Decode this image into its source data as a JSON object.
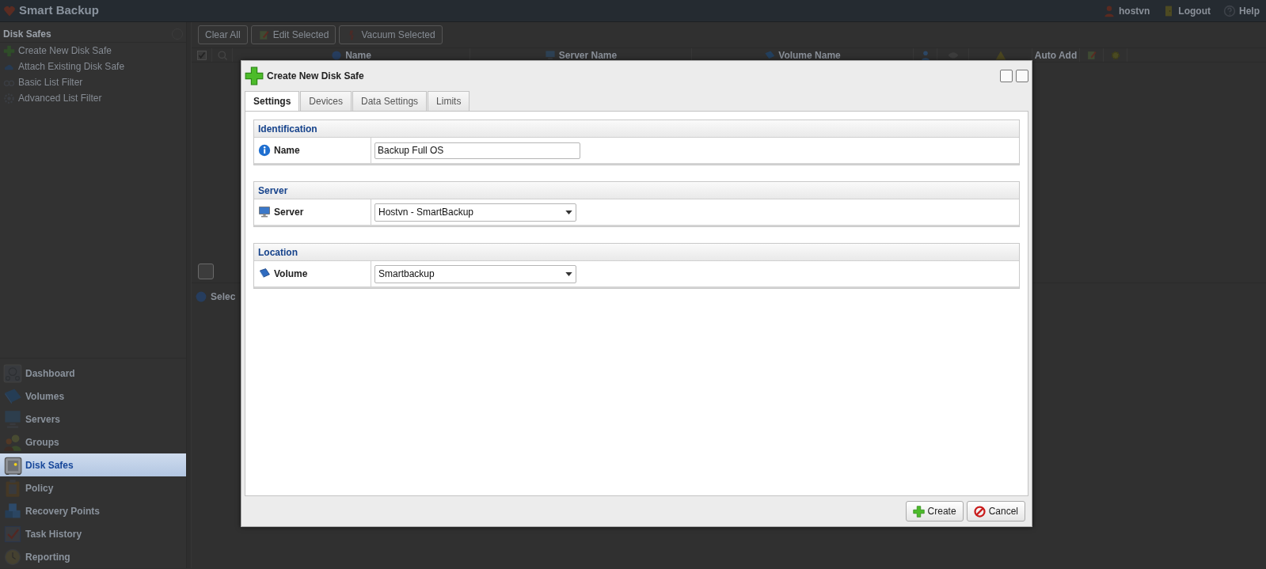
{
  "app": {
    "title": "Smart Backup",
    "user_menu": [
      {
        "kind": "user",
        "label": "hostvn"
      },
      {
        "kind": "logout",
        "label": "Logout"
      },
      {
        "kind": "help",
        "label": "Help"
      }
    ]
  },
  "sidebar": {
    "title": "Disk Safes",
    "actions": [
      {
        "kind": "create",
        "label": "Create New Disk Safe"
      },
      {
        "kind": "attach",
        "label": "Attach Existing Disk Safe"
      },
      {
        "kind": "basic_filter",
        "label": "Basic List Filter"
      },
      {
        "kind": "advanced_filter",
        "label": "Advanced List Filter"
      }
    ],
    "nav": [
      {
        "kind": "dashboard",
        "label": "Dashboard",
        "selected": false
      },
      {
        "kind": "volumes",
        "label": "Volumes",
        "selected": false
      },
      {
        "kind": "servers",
        "label": "Servers",
        "selected": false
      },
      {
        "kind": "groups",
        "label": "Groups",
        "selected": false
      },
      {
        "kind": "disk_safes",
        "label": "Disk Safes",
        "selected": true
      },
      {
        "kind": "policy",
        "label": "Policy",
        "selected": false
      },
      {
        "kind": "recovery",
        "label": "Recovery Points",
        "selected": false
      },
      {
        "kind": "tasks",
        "label": "Task History",
        "selected": false
      },
      {
        "kind": "reporting",
        "label": "Reporting",
        "selected": false
      }
    ]
  },
  "toolbar": [
    {
      "kind": "clear",
      "label": "Clear All"
    },
    {
      "kind": "edit",
      "label": "Edit Selected"
    },
    {
      "kind": "vacuum",
      "label": "Vacuum Selected"
    }
  ],
  "table": {
    "columns": [
      {
        "kind": "check",
        "checked": true
      },
      {
        "kind": "search"
      },
      {
        "kind": "name",
        "label": "Name"
      },
      {
        "kind": "server",
        "label": "Server Name"
      },
      {
        "kind": "volume",
        "label": "Volume Name"
      },
      {
        "kind": "user"
      },
      {
        "kind": "eye"
      },
      {
        "kind": "warning"
      },
      {
        "kind": "text",
        "label": "Auto Add"
      },
      {
        "kind": "edit"
      },
      {
        "kind": "gear"
      }
    ]
  },
  "details": {
    "title": "Selec"
  },
  "dialog": {
    "title": "Create New Disk Safe",
    "tabs": [
      {
        "label": "Settings",
        "selected": true
      },
      {
        "label": "Devices",
        "selected": false
      },
      {
        "label": "Data Settings",
        "selected": false
      },
      {
        "label": "Limits",
        "selected": false
      }
    ],
    "sections": [
      {
        "title": "Identification",
        "fields": [
          {
            "kind": "text",
            "label": "Name",
            "value": "Backup Full OS"
          }
        ]
      },
      {
        "title": "Server",
        "fields": [
          {
            "kind": "select",
            "label": "Server",
            "value": "Hostvn - SmartBackup"
          }
        ]
      },
      {
        "title": "Location",
        "fields": [
          {
            "kind": "select",
            "label": "Volume",
            "value": "Smartbackup"
          }
        ]
      }
    ],
    "buttons": [
      {
        "kind": "create",
        "label": "Create"
      },
      {
        "kind": "cancel",
        "label": "Cancel"
      }
    ]
  }
}
